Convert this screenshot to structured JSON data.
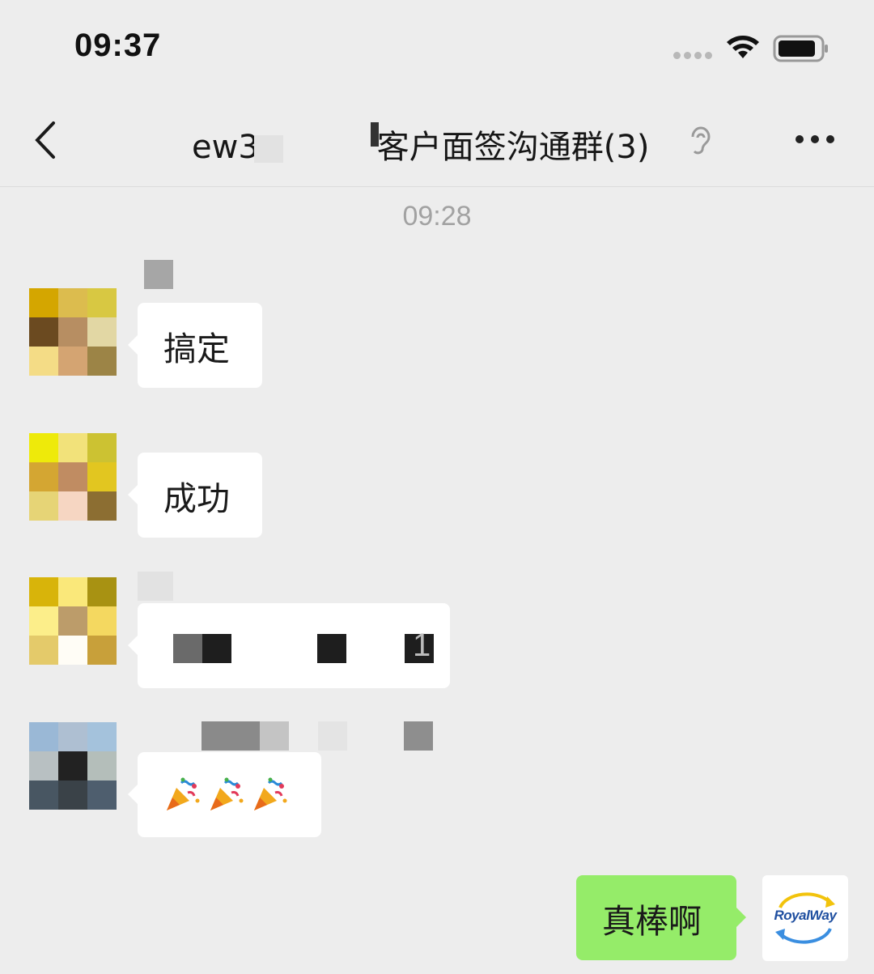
{
  "status_bar": {
    "time": "09:37"
  },
  "nav": {
    "title_prefix": "ew3",
    "title_main": "客户面签沟通群(3)"
  },
  "timestamp": "09:28",
  "messages": [
    {
      "text": "搞定"
    },
    {
      "text": "成功"
    },
    {
      "text": "1"
    },
    {
      "text": ""
    }
  ],
  "my_message": {
    "text": "真棒啊"
  },
  "my_avatar": {
    "logo": "RoyalWay"
  },
  "icons": [
    "back-chevron-icon",
    "wifi-icon",
    "battery-icon",
    "ear-icon",
    "more-dots-icon",
    "party-popper-icon"
  ],
  "colors": {
    "background": "#ededed",
    "my_bubble": "#95ec69",
    "other_bubble": "#ffffff"
  }
}
